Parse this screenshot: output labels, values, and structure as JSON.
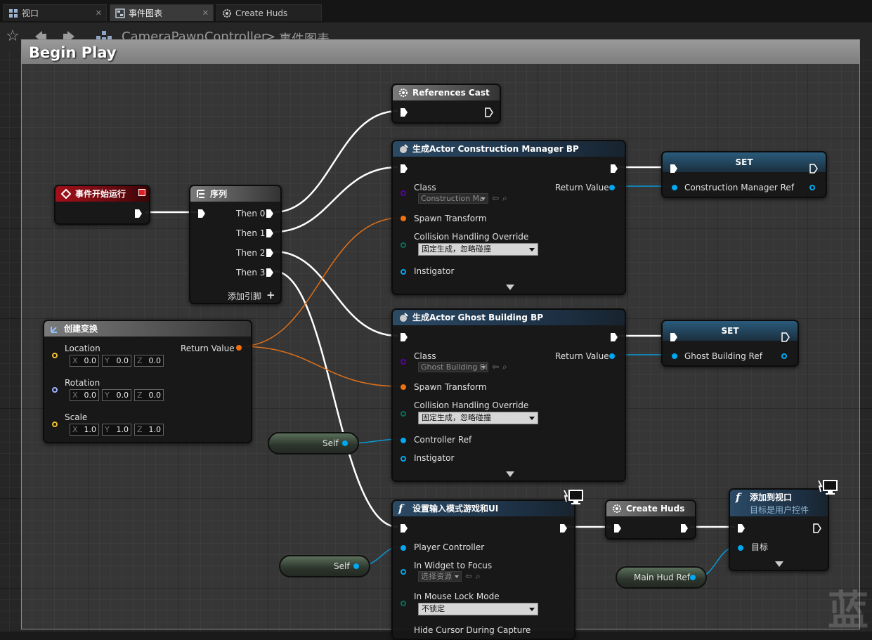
{
  "tabs": [
    {
      "label": "视口",
      "icon": "viewport-icon"
    },
    {
      "label": "事件图表",
      "icon": "event-graph-icon"
    },
    {
      "label": "Create Huds",
      "icon": "function-gear-icon"
    }
  ],
  "breadcrumb": {
    "blueprint": "CameraPawnController",
    "separator": ">",
    "graph": "事件图表"
  },
  "comment": {
    "title": "Begin Play"
  },
  "nodes": {
    "begin": {
      "title": "事件开始运行"
    },
    "sequence": {
      "title": "序列",
      "pins": [
        "Then 0",
        "Then 1",
        "Then 2",
        "Then 3"
      ],
      "add_pin": "添加引脚"
    },
    "refcast": {
      "title": "References Cast"
    },
    "spawn1": {
      "title": "生成Actor Construction Manager BP",
      "class_label": "Class",
      "class_value": "Construction Ma",
      "return_value": "Return Value",
      "spawn_transform": "Spawn Transform",
      "collision": "Collision Handling Override",
      "collision_value": "固定生成，忽略碰撞",
      "instigator": "Instigator"
    },
    "set1": {
      "title": "SET",
      "var": "Construction Manager Ref"
    },
    "transform": {
      "title": "创建变换",
      "return_value": "Return Value",
      "location": "Location",
      "rotation": "Rotation",
      "scale": "Scale",
      "x": "X",
      "y": "Y",
      "z": "Z",
      "loc": [
        "0.0",
        "0.0",
        "0.0"
      ],
      "rot": [
        "0.0",
        "0.0",
        "0.0"
      ],
      "scl": [
        "1.0",
        "1.0",
        "1.0"
      ]
    },
    "spawn2": {
      "title": "生成Actor Ghost Building BP",
      "class_label": "Class",
      "class_value": "Ghost Building Bl",
      "return_value": "Return Value",
      "spawn_transform": "Spawn Transform",
      "collision": "Collision Handling Override",
      "collision_value": "固定生成，忽略碰撞",
      "controller_ref": "Controller Ref",
      "instigator": "Instigator"
    },
    "set2": {
      "title": "SET",
      "var": "Ghost Building Ref"
    },
    "self1": {
      "label": "Self"
    },
    "self2": {
      "label": "Self"
    },
    "inputmode": {
      "title": "设置输入模式游戏和UI",
      "player_controller": "Player Controller",
      "widget_focus": "In Widget to Focus",
      "widget_focus_value": "选择资源",
      "mouse_lock": "In Mouse Lock Mode",
      "mouse_lock_value": "不锁定",
      "hide_cursor": "Hide Cursor During Capture"
    },
    "createhuds": {
      "title": "Create Huds"
    },
    "addviewport": {
      "title": "添加到视口",
      "subtitle": "目标是用户控件",
      "target": "目标"
    },
    "mainhud": {
      "label": "Main Hud Ref"
    }
  },
  "watermark": "蓝",
  "colors": {
    "exec": "#ffffff",
    "object": "#00a8f0",
    "struct_transform": "#f07010",
    "enum": "#0a6d56",
    "class": "#5a00a0",
    "vector": "#f0c030",
    "rotator": "#a0b4ff",
    "event_header": "#a3101a"
  }
}
